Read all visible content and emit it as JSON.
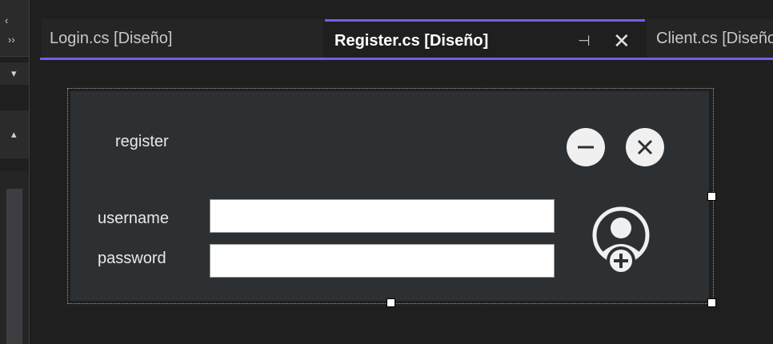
{
  "tabs": [
    {
      "label": "Login.cs [Diseño]"
    },
    {
      "label": "Register.cs [Diseño]",
      "active": true
    },
    {
      "label": "Client.cs [Diseño]"
    }
  ],
  "tab_controls": {
    "pin": "⊣",
    "close": "✕"
  },
  "form": {
    "title": "register",
    "username_label": "username",
    "password_label": "password",
    "username_value": "",
    "password_value": "",
    "minimize_icon": "minus-circle-icon",
    "close_icon": "x-circle-icon",
    "add_user_icon": "add-user-icon"
  },
  "colors": {
    "accent": "#7160e8",
    "form_bg": "#2d3033",
    "ide_bg": "#1f1f1f"
  }
}
